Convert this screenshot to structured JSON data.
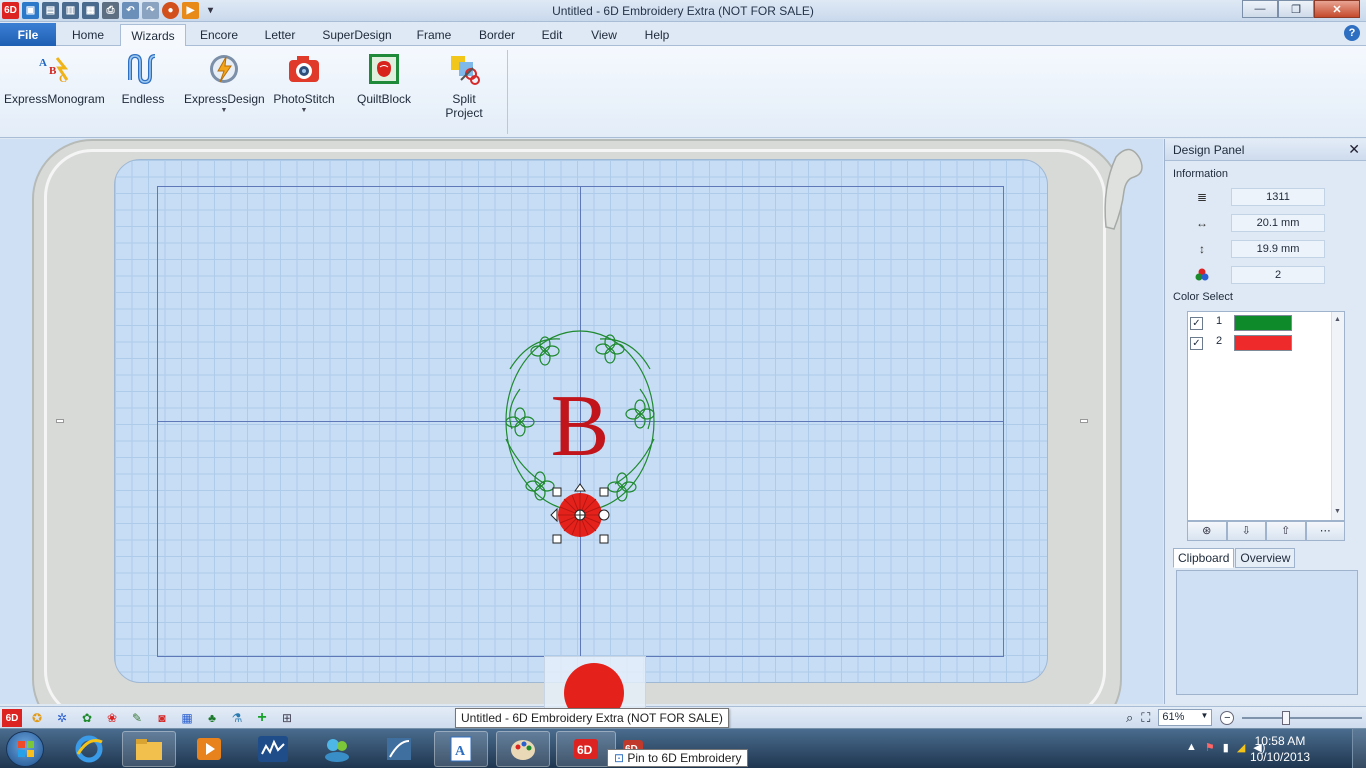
{
  "window": {
    "title": "Untitled - 6D Embroidery Extra (NOT FOR SALE)",
    "minimize": "—",
    "maximize": "❐",
    "close": "✕"
  },
  "ribbon": {
    "file_tab": "File",
    "tabs": [
      "Home",
      "Wizards",
      "Encore",
      "Letter",
      "SuperDesign",
      "Frame",
      "Border",
      "Edit",
      "View",
      "Help"
    ],
    "active_tab": "Wizards",
    "help": "?",
    "buttons": [
      {
        "label": "ExpressMonogram",
        "icon": "express-monogram-icon",
        "dropdown": false
      },
      {
        "label": "Endless",
        "icon": "endless-icon",
        "dropdown": false
      },
      {
        "label": "ExpressDesign",
        "icon": "express-design-icon",
        "dropdown": true
      },
      {
        "label": "PhotoStitch",
        "icon": "photostitch-icon",
        "dropdown": true
      },
      {
        "label": "QuiltBlock",
        "icon": "quiltblock-icon",
        "dropdown": false
      },
      {
        "label": "Split\nProject",
        "label_line1": "Split",
        "label_line2": "Project",
        "icon": "split-project-icon",
        "dropdown": false
      }
    ]
  },
  "canvas": {
    "monogram_letter": "B",
    "colors": {
      "frame": "#1f8a2f",
      "letter": "#c1151b",
      "flower": "#e4221b"
    }
  },
  "design_panel": {
    "title": "Design Panel",
    "close": "✕",
    "information_label": "Information",
    "stitches": "1311",
    "width": "20.1 mm",
    "height": "19.9 mm",
    "colors_count": "2",
    "color_select_label": "Color Select",
    "colors": [
      {
        "number": "1",
        "swatch": "#0f8a2a",
        "checked": true
      },
      {
        "number": "2",
        "swatch": "#ef2a2a",
        "checked": true
      }
    ],
    "tabs": [
      "Clipboard",
      "Overview"
    ],
    "active_tab": "Clipboard"
  },
  "statusbar": {
    "zoom": "61%",
    "tooltip": "Untitled - 6D Embroidery Extra (NOT FOR SALE)"
  },
  "taskbar": {
    "time": "10:58 AM",
    "date": "10/10/2013",
    "jump_tooltip": "Pin to 6D Embroidery"
  }
}
